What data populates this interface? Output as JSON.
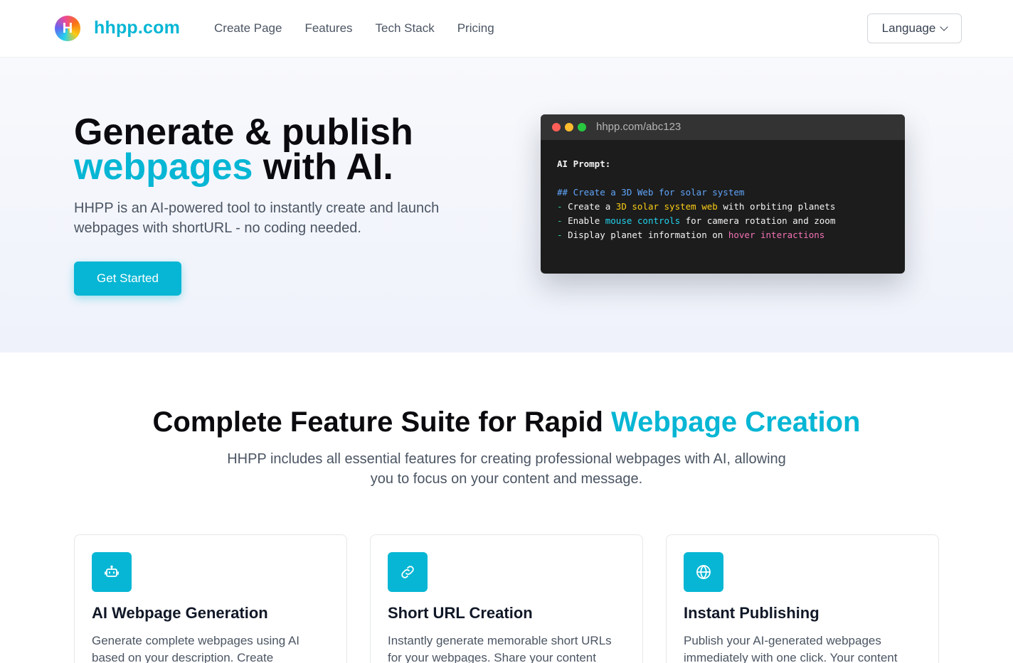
{
  "header": {
    "logo_letter": "H",
    "brand": "hhpp.com",
    "nav": [
      "Create Page",
      "Features",
      "Tech Stack",
      "Pricing"
    ],
    "language_label": "Language"
  },
  "hero": {
    "title_line1": "Generate & publish",
    "title_accent": "webpages",
    "title_rest": " with AI.",
    "description": "HHPP is an AI-powered tool to instantly create and launch webpages with shortURL - no coding needed.",
    "cta": "Get Started",
    "preview": {
      "url": "hhpp.com/abc123",
      "prompt_label": "AI Prompt:",
      "heading": "## Create a 3D Web for solar system",
      "line1": {
        "dash": "- ",
        "a": "Create a ",
        "b": "3D solar system web",
        "c": " with orbiting planets"
      },
      "line2": {
        "dash": "- ",
        "a": "Enable ",
        "b": "mouse controls",
        "c": " for camera rotation and zoom"
      },
      "line3": {
        "dash": "- ",
        "a": "Display planet information on ",
        "b": "hover interactions",
        "c": ""
      }
    }
  },
  "features": {
    "title_main": "Complete Feature Suite for Rapid ",
    "title_accent": "Webpage Creation",
    "description": "HHPP includes all essential features for creating professional webpages with AI, allowing you to focus on your content and message.",
    "cards": [
      {
        "icon": "robot-icon",
        "title": "AI Webpage Generation",
        "text": "Generate complete webpages using AI based on your description. Create"
      },
      {
        "icon": "link-icon",
        "title": "Short URL Creation",
        "text": "Instantly generate memorable short URLs for your webpages. Share your content"
      },
      {
        "icon": "globe-icon",
        "title": "Instant Publishing",
        "text": "Publish your AI-generated webpages immediately with one click. Your content"
      }
    ]
  },
  "colors": {
    "accent": "#06b6d4",
    "terminal_bg": "#1c1c1c",
    "dot_red": "#ff5f57",
    "dot_yellow": "#febc2e",
    "dot_green": "#28c840"
  }
}
